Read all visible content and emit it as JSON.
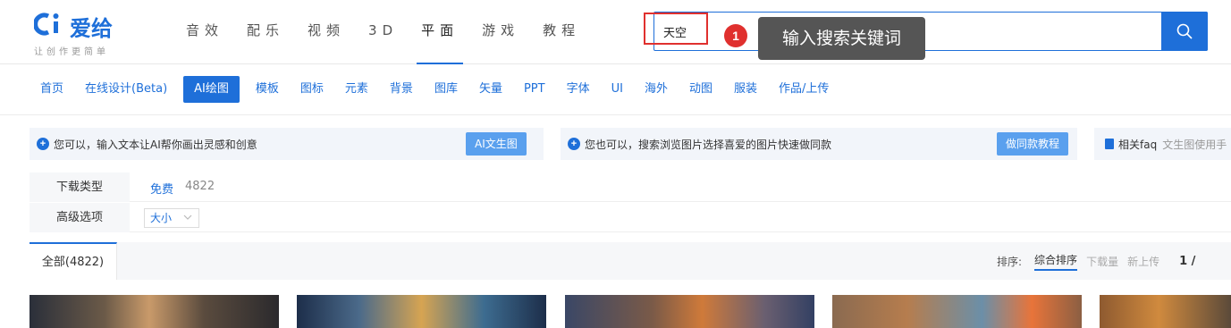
{
  "logo": {
    "name": "爱给",
    "slogan": "让创作更简单"
  },
  "top_nav": [
    {
      "label": "音效"
    },
    {
      "label": "配乐"
    },
    {
      "label": "视频"
    },
    {
      "label": "3D"
    },
    {
      "label": "平面",
      "active": true
    },
    {
      "label": "游戏"
    },
    {
      "label": "教程"
    }
  ],
  "search": {
    "query": "天空"
  },
  "annotation": {
    "step": "1",
    "tip": "输入搜索关键词"
  },
  "sub_nav": [
    {
      "label": "首页"
    },
    {
      "label": "在线设计(Beta)"
    },
    {
      "label": "AI绘图",
      "active": true
    },
    {
      "label": "模板"
    },
    {
      "label": "图标"
    },
    {
      "label": "元素"
    },
    {
      "label": "背景"
    },
    {
      "label": "图库"
    },
    {
      "label": "矢量"
    },
    {
      "label": "PPT"
    },
    {
      "label": "字体"
    },
    {
      "label": "UI"
    },
    {
      "label": "海外"
    },
    {
      "label": "动图"
    },
    {
      "label": "服装"
    },
    {
      "label": "作品/上传"
    }
  ],
  "info_bars": {
    "ai_text": {
      "text": "您可以，输入文本让AI帮你画出灵感和创意",
      "action": "AI文生图"
    },
    "same_style": {
      "text": "您也可以，搜索浏览图片选择喜爱的图片快速做同款",
      "action": "做同款教程"
    },
    "faq": {
      "label": "相关faq",
      "text": "文生图使用手"
    }
  },
  "filters": {
    "download_type": {
      "label": "下载类型",
      "value": "免费",
      "count": "4822"
    },
    "advanced": {
      "label": "高级选项",
      "select": "大小"
    }
  },
  "results": {
    "tab_all": "全部(4822)",
    "sort_label": "排序:",
    "sort_options": [
      "综合排序",
      "下载量",
      "新上传"
    ],
    "page": "1 /"
  },
  "colors": {
    "accent": "#1e6fd9",
    "highlight": "#e0302e"
  }
}
